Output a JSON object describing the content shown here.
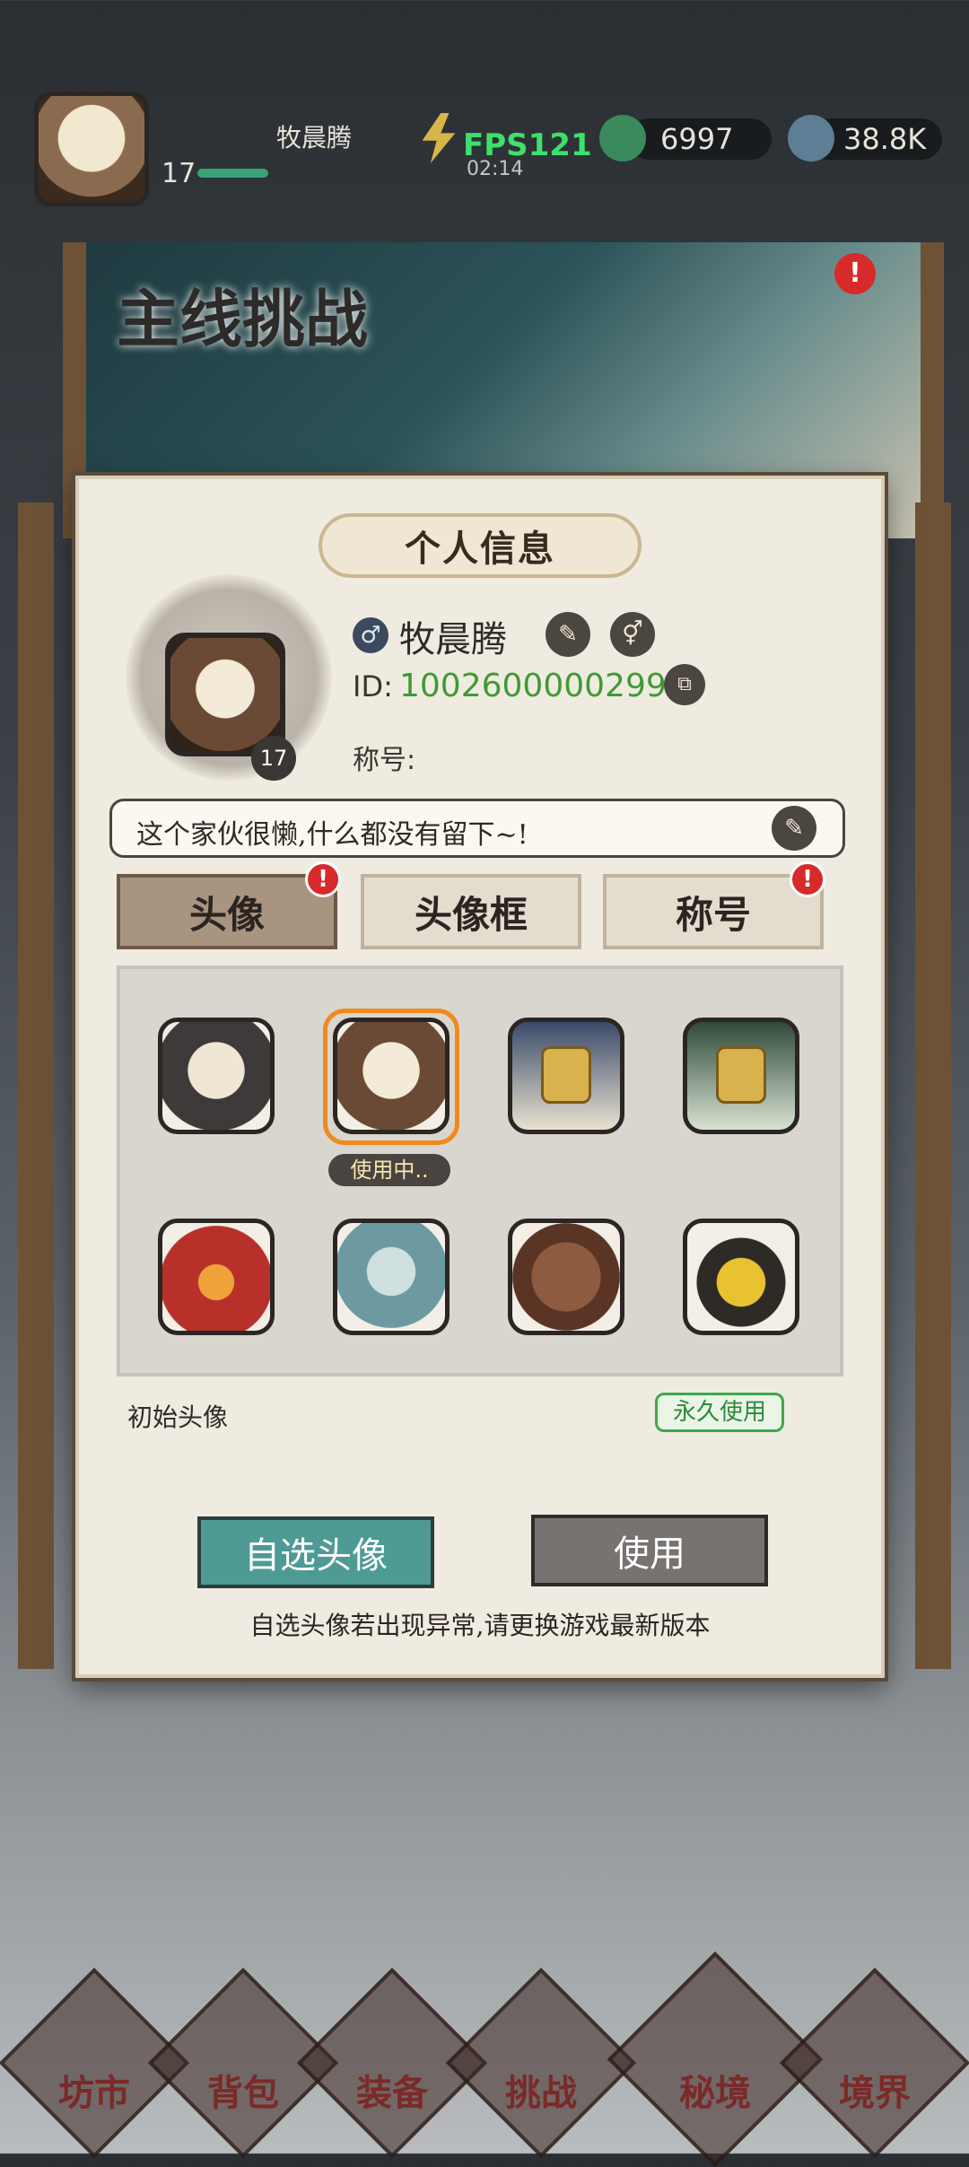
{
  "hud": {
    "player_name": "牧晨腾",
    "level": "17",
    "exp_fraction": 0.33,
    "fps": "FPS121",
    "time": "02:14",
    "jade": "6997",
    "crystal": "38.8K"
  },
  "banner": {
    "title": "主线挑战"
  },
  "panel": {
    "title": "个人信息",
    "player_name": "牧晨腾",
    "level": "17",
    "id_label": "ID:",
    "id_value": "10026000002999",
    "title_label": "称号:",
    "signature": "这个家伙很懒,什么都没有留下~!",
    "tabs": [
      {
        "label": "头像",
        "active": true,
        "badge": "!"
      },
      {
        "label": "头像框",
        "active": false
      },
      {
        "label": "称号",
        "active": false,
        "badge": "!"
      }
    ],
    "avatars": [
      {
        "name": "avatar-1",
        "locked": false
      },
      {
        "name": "avatar-2",
        "locked": false,
        "in_use": true
      },
      {
        "name": "avatar-3",
        "locked": true
      },
      {
        "name": "avatar-4",
        "locked": true
      },
      {
        "name": "avatar-5",
        "locked": false
      },
      {
        "name": "avatar-6",
        "locked": false
      },
      {
        "name": "avatar-7",
        "locked": false
      },
      {
        "name": "avatar-8",
        "locked": false
      }
    ],
    "in_use_label": "使用中..",
    "selected_avatar_name": "初始头像",
    "permanent_label": "永久使用",
    "custom_button": "自选头像",
    "use_button": "使用",
    "footer_note": "自选头像若出现异常,请更换游戏最新版本"
  },
  "nav": [
    "坊市",
    "背包",
    "装备",
    "挑战",
    "秘境",
    "境界"
  ],
  "colors": {
    "accent_green": "#3f9a35",
    "badge_red": "#d72a2a",
    "use_orange": "#f08a1c"
  }
}
